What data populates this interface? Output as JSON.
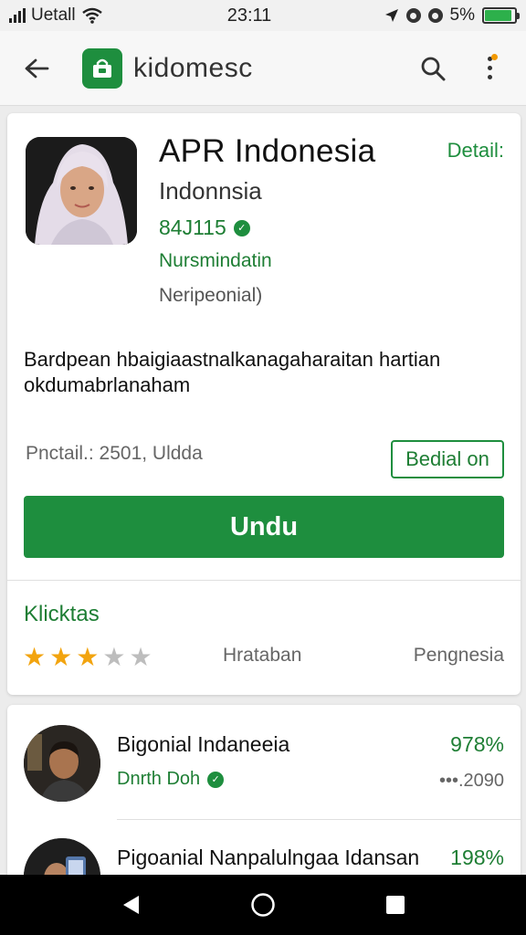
{
  "status_bar": {
    "carrier": "Uetall",
    "time": "23:11",
    "battery": "5%",
    "battery_level": 0.92,
    "battery_color": "#2db04b"
  },
  "app_bar": {
    "brand": "kidomesc",
    "icons": [
      "back-arrow-icon",
      "store-bag-icon",
      "search-icon",
      "more-vert-icon"
    ],
    "accent": "#1e8e3e"
  },
  "app": {
    "title": "APR Indonesia",
    "detail_link": "Detail:",
    "subtitle": "Indonnsia",
    "rating_text": "84J115",
    "developer": "Nursmindatin",
    "note": "Neripeonial)",
    "description": "Bardpean hbaigiaastnalkanagaharaitan hartian okdumabrlanaham",
    "meta": "Pnctail.: 2501, Uldda",
    "secondary_button": "Bedial on",
    "primary_button": "Undu"
  },
  "ratings": {
    "section_title": "Klicktas",
    "stars_filled": 3,
    "stars_total": 5,
    "stat_a": "Hrataban",
    "stat_b": "Pengnesia",
    "star_color": "#f2a40f"
  },
  "list": [
    {
      "name": "Bigonial Indaneeia",
      "percent": "978%",
      "sub": "Dnrth Doh",
      "date": "•••.2090"
    },
    {
      "name": "Pigoanial Nanpalulngaa Idansan",
      "percent": "198%",
      "sub": "",
      "date": ""
    }
  ]
}
